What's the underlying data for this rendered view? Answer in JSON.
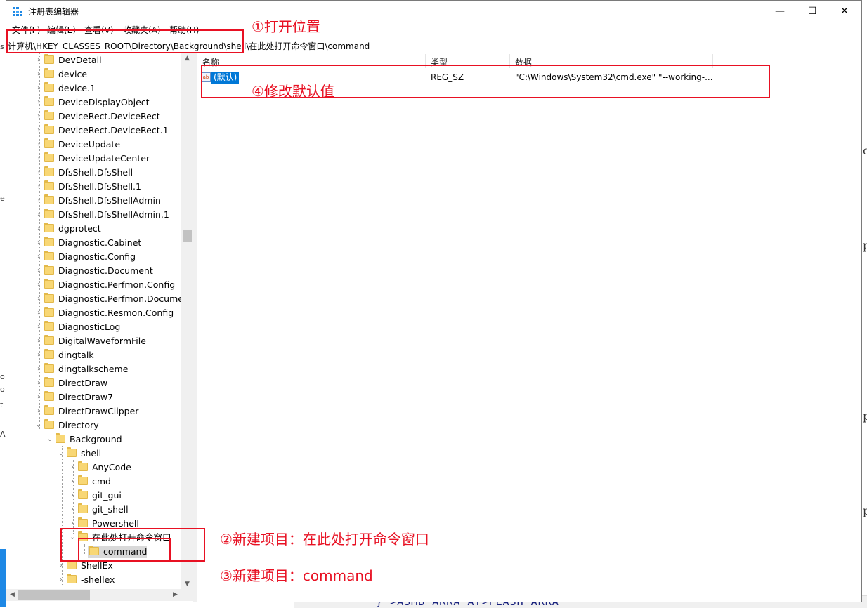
{
  "window": {
    "title": "注册表编辑器",
    "minimize_glyph": "—",
    "maximize_glyph": "☐",
    "close_glyph": "✕"
  },
  "menu": [
    "文件(F)",
    "编辑(E)",
    "查看(V)",
    "收藏夹(A)",
    "帮助(H)"
  ],
  "address": "计算机\\HKEY_CLASSES_ROOT\\Directory\\Background\\shell\\在此处打开命令窗口\\command",
  "tree": {
    "top_items": [
      "DevDetail",
      "device",
      "device.1",
      "DeviceDisplayObject",
      "DeviceRect.DeviceRect",
      "DeviceRect.DeviceRect.1",
      "DeviceUpdate",
      "DeviceUpdateCenter",
      "DfsShell.DfsShell",
      "DfsShell.DfsShell.1",
      "DfsShell.DfsShellAdmin",
      "DfsShell.DfsShellAdmin.1",
      "dgprotect",
      "Diagnostic.Cabinet",
      "Diagnostic.Config",
      "Diagnostic.Document",
      "Diagnostic.Perfmon.Config",
      "Diagnostic.Perfmon.Document",
      "Diagnostic.Resmon.Config",
      "DiagnosticLog",
      "DigitalWaveformFile",
      "dingtalk",
      "dingtalkscheme",
      "DirectDraw",
      "DirectDraw7",
      "DirectDrawClipper"
    ],
    "directory": "Directory",
    "background": "Background",
    "shell": "shell",
    "shell_children": [
      "AnyCode",
      "cmd",
      "git_gui",
      "git_shell",
      "Powershell",
      "在此处打开命令窗口"
    ],
    "command": "command",
    "after_shell": [
      "ShellEx",
      "-shellex"
    ]
  },
  "list": {
    "headers": {
      "name": "名称",
      "type": "类型",
      "data": "数据"
    },
    "row": {
      "icon": "ab",
      "name": "(默认)",
      "type": "REG_SZ",
      "data": "\"C:\\Windows\\System32\\cmd.exe\" \"--working-..."
    }
  },
  "annotations": {
    "a1": "①打开位置",
    "a2": "②新建项目：在此处打开命令窗口",
    "a3": "③新建项目：command",
    "a4": "④修改默认值"
  },
  "background_fragments": {
    "bottom_text": "} >ASMB ARRA AT>FLASH ARRA"
  },
  "colors": {
    "accent": "#0078d7",
    "annotation": "#e81123",
    "folder": "#f8d775"
  }
}
